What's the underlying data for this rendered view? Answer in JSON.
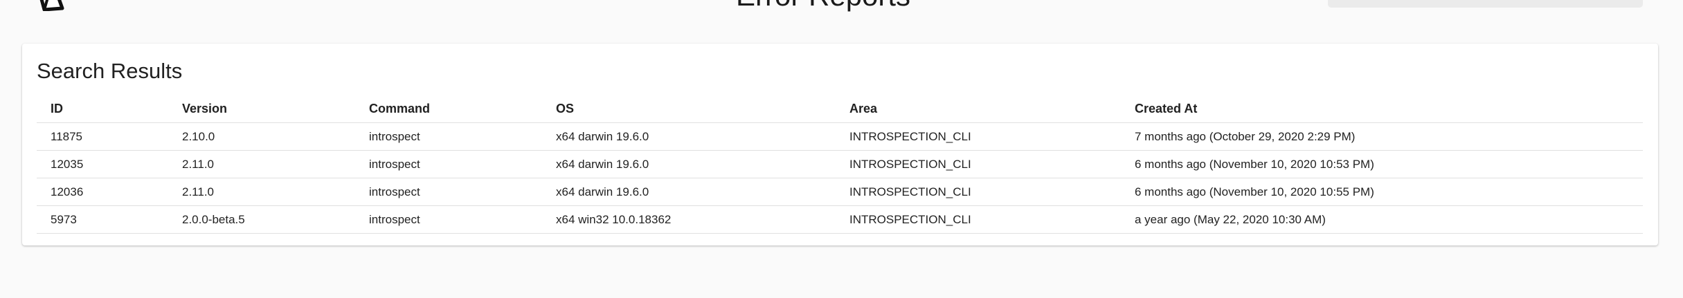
{
  "header": {
    "title": "Error Reports"
  },
  "results": {
    "title": "Search Results",
    "columns": [
      "ID",
      "Version",
      "Command",
      "OS",
      "Area",
      "Created At"
    ],
    "rows": [
      {
        "id": "11875",
        "version": "2.10.0",
        "command": "introspect",
        "os": "x64 darwin 19.6.0",
        "area": "INTROSPECTION_CLI",
        "created_at": "7 months ago (October 29, 2020 2:29 PM)"
      },
      {
        "id": "12035",
        "version": "2.11.0",
        "command": "introspect",
        "os": "x64 darwin 19.6.0",
        "area": "INTROSPECTION_CLI",
        "created_at": "6 months ago (November 10, 2020 10:53 PM)"
      },
      {
        "id": "12036",
        "version": "2.11.0",
        "command": "introspect",
        "os": "x64 darwin 19.6.0",
        "area": "INTROSPECTION_CLI",
        "created_at": "6 months ago (November 10, 2020 10:55 PM)"
      },
      {
        "id": "5973",
        "version": "2.0.0-beta.5",
        "command": "introspect",
        "os": "x64 win32 10.0.18362",
        "area": "INTROSPECTION_CLI",
        "created_at": "a year ago (May 22, 2020 10:30 AM)"
      }
    ]
  },
  "icons": {
    "logo": "prisma-logo-icon"
  }
}
